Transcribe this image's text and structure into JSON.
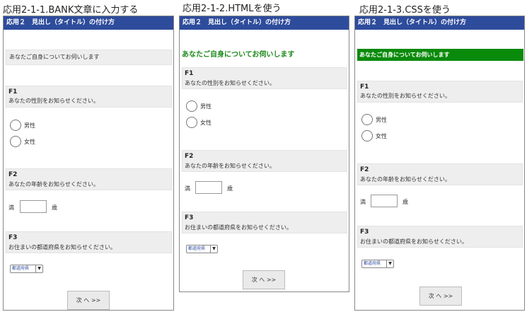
{
  "captions": [
    "応用2-1-1.BANK文章に入力する",
    "応用2-1-2.HTMLを使う",
    "応用2-1-3.CSSを使う"
  ],
  "header_title": "応用２　見出し（タイトル）の付け方",
  "section_title": "あなたご自身についてお伺いします",
  "questions": {
    "f1": {
      "num": "F1",
      "text": "あなたの性別をお知らせください。",
      "options": [
        "男性",
        "女性"
      ]
    },
    "f2": {
      "num": "F2",
      "text": "あなたの年齢をお知らせください。",
      "prefix": "満",
      "suffix": "歳"
    },
    "f3": {
      "num": "F3",
      "text": "お住まいの都道府県をお知らせください。",
      "select_value": "都道府県"
    }
  },
  "next_button": "次 へ >>",
  "colors": {
    "header": "#2e4c9c",
    "green_title": "#1d8a1d",
    "green_bar": "#0a8a0a",
    "question_box": "#eeeeee"
  },
  "icons": {
    "radio": "radio-button-icon",
    "dropdown": "chevron-down-icon"
  }
}
